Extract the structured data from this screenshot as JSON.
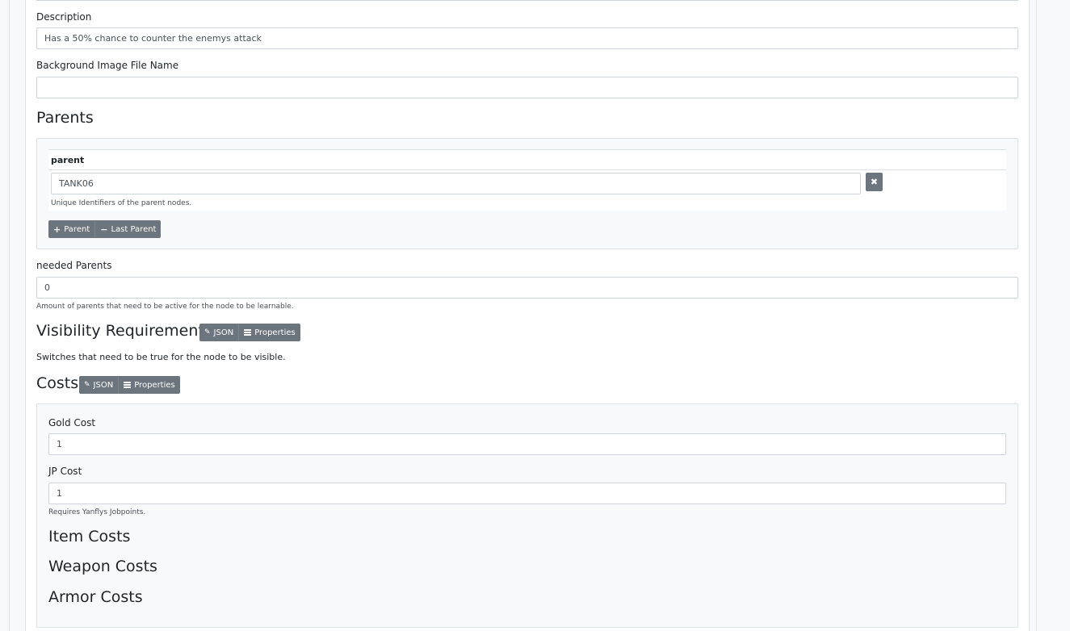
{
  "description": {
    "label": "Description",
    "value": "Has a 50% chance to counter the enemys attack"
  },
  "background_image": {
    "label": "Background Image File Name",
    "value": ""
  },
  "parents": {
    "heading": "Parents",
    "column_header": "parent",
    "rows": [
      {
        "value": "TANK06"
      }
    ],
    "help": "Unique Identifiers of the parent nodes.",
    "add_label": "Parent",
    "remove_label": "Last Parent"
  },
  "needed_parents": {
    "label": "needed Parents",
    "value": "0",
    "help": "Amount of parents that need to be active for the node to be learnable."
  },
  "visibility": {
    "heading": "Visibility Requirements",
    "json_label": "JSON",
    "properties_label": "Properties",
    "description": "Switches that need to be true for the node to be visible."
  },
  "costs": {
    "heading": "Costs",
    "json_label": "JSON",
    "properties_label": "Properties",
    "gold": {
      "label": "Gold Cost",
      "value": "1"
    },
    "jp": {
      "label": "JP Cost",
      "value": "1",
      "help": "Requires Yanflys Jobpoints."
    },
    "item_costs_heading": "Item Costs",
    "weapon_costs_heading": "Weapon Costs",
    "armor_costs_heading": "Armor Costs"
  },
  "icons": {
    "plus": "plus-icon",
    "minus": "minus-icon",
    "remove": "times-icon",
    "edit": "pencil-icon",
    "list": "list-icon"
  },
  "colors": {
    "button_bg": "#6c757d",
    "input_border": "#ced4da",
    "well_bg": "#f8f9fa"
  }
}
